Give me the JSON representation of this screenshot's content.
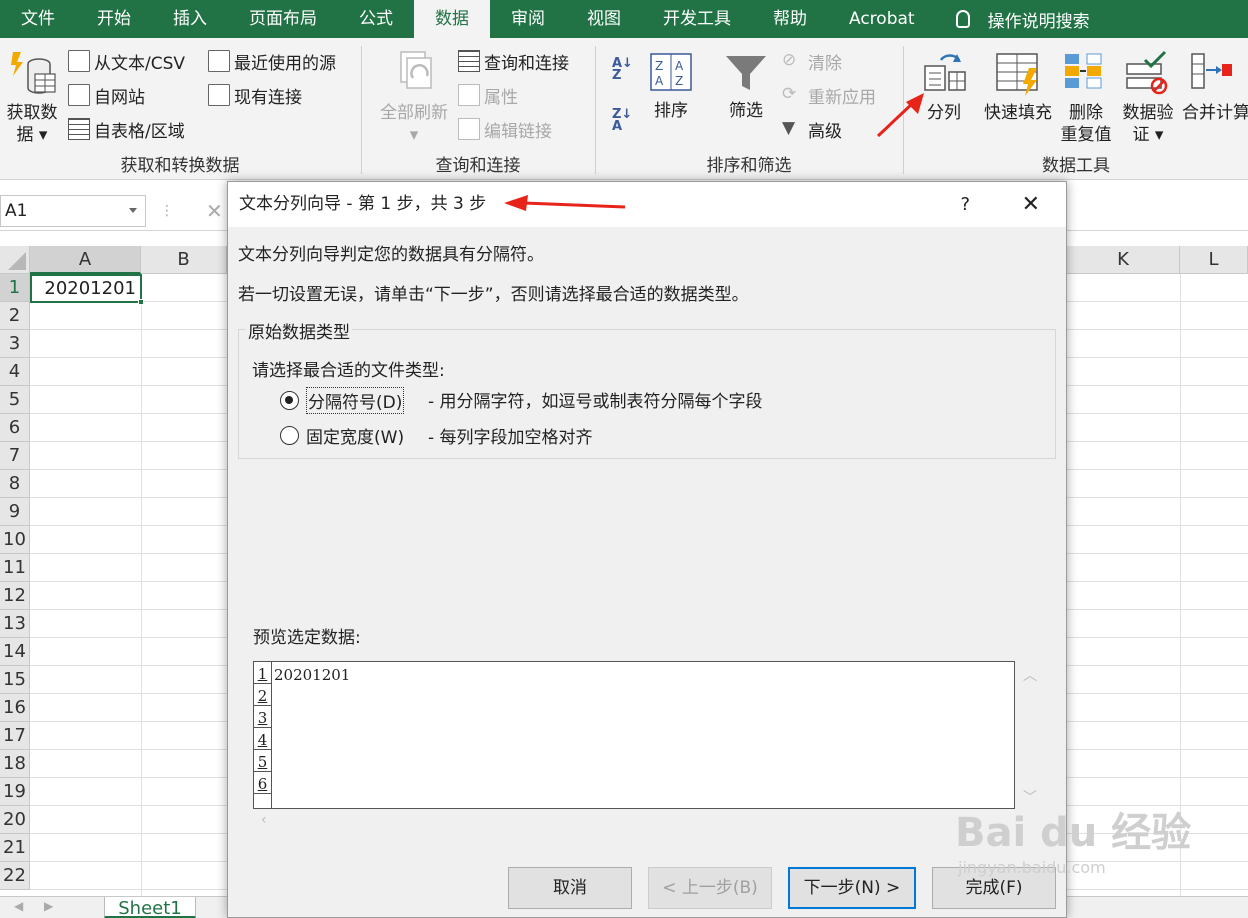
{
  "menu": {
    "tabs": [
      "文件",
      "开始",
      "插入",
      "页面布局",
      "公式",
      "数据",
      "审阅",
      "视图",
      "开发工具",
      "帮助",
      "Acrobat"
    ],
    "active_tab": "数据",
    "search_label": "操作说明搜索"
  },
  "ribbon": {
    "get_transform": {
      "get_data_line1": "获取数",
      "get_data_line2": "据",
      "from_text_csv": "从文本/CSV",
      "from_web": "自网站",
      "from_table": "自表格/区域",
      "recent_sources": "最近使用的源",
      "existing_connections": "现有连接",
      "label": "获取和转换数据"
    },
    "queries": {
      "refresh_all": "全部刷新",
      "queries_connections": "查询和连接",
      "properties": "属性",
      "edit_links": "编辑链接",
      "label": "查询和连接"
    },
    "sort_filter": {
      "sort": "排序",
      "filter": "筛选",
      "clear": "清除",
      "reapply": "重新应用",
      "advanced": "高级",
      "label": "排序和筛选"
    },
    "data_tools": {
      "text_to_columns": "分列",
      "flash_fill": "快速填充",
      "remove_dup_line1": "删除",
      "remove_dup_line2": "重复值",
      "validation_line1": "数据验",
      "validation_line2": "证",
      "consolidate": "合并计算",
      "label": "数据工具"
    }
  },
  "formula_bar": {
    "name_box": "A1"
  },
  "sheet": {
    "columns": [
      "A",
      "B",
      "K",
      "L"
    ],
    "rows": [
      "1",
      "2",
      "3",
      "4",
      "5",
      "6",
      "7",
      "8",
      "9",
      "10",
      "11",
      "12",
      "13",
      "14",
      "15",
      "16",
      "17",
      "18",
      "19",
      "20",
      "21",
      "22"
    ],
    "a1_value": "20201201",
    "tab": "Sheet1"
  },
  "dialog": {
    "title": "文本分列向导 - 第 1 步，共 3 步",
    "help": "?",
    "close": "✕",
    "intro": "文本分列向导判定您的数据具有分隔符。",
    "hint": "若一切设置无误，请单击“下一步”，否则请选择最合适的数据类型。",
    "group_label": "原始数据类型",
    "choose_label": "请选择最合适的文件类型:",
    "options": [
      {
        "label": "分隔符号(D)",
        "desc": "- 用分隔字符，如逗号或制表符分隔每个字段",
        "selected": true
      },
      {
        "label": "固定宽度(W)",
        "desc": "- 每列字段加空格对齐",
        "selected": false
      }
    ],
    "preview_label": "预览选定数据:",
    "preview_rows": [
      "1",
      "2",
      "3",
      "4",
      "5",
      "6"
    ],
    "preview_value": "20201201",
    "buttons": {
      "cancel": "取消",
      "back": "< 上一步(B)",
      "next": "下一步(N) >",
      "finish": "完成(F)"
    }
  },
  "watermark": {
    "text": "Bai du 经验",
    "sub": "jingyan.baidu.com"
  },
  "colors": {
    "excel_green": "#217346",
    "annotation_red": "#e8231a",
    "focus_blue": "#0078d7"
  }
}
